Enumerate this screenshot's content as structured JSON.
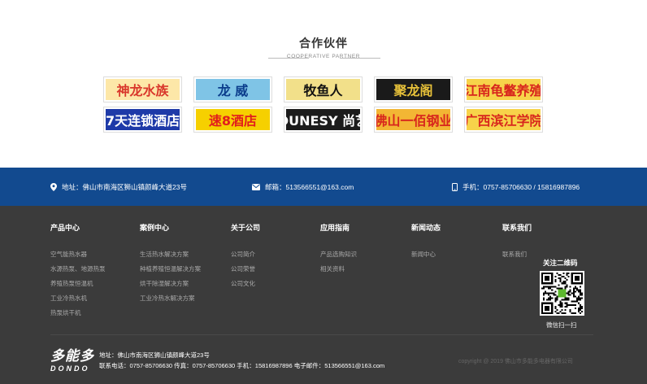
{
  "partners": {
    "title": "合作伙伴",
    "subtitle": "COOPERATIVE PARTNER",
    "logos": [
      {
        "text": "神龙水族",
        "color": "#d9372b",
        "bg": "#fde7a8"
      },
      {
        "text": "龙 威",
        "color": "#0b3d8c",
        "bg": "#7fc4e6"
      },
      {
        "text": "牧鱼人",
        "color": "#111111",
        "bg": "#f2e08a"
      },
      {
        "text": "聚龙阁",
        "color": "#e8c23a",
        "bg": "#1a1a1a"
      },
      {
        "text": "江南龟鳖养殖",
        "color": "#d8261d",
        "bg": "#f7d34a"
      },
      {
        "text": "7天连锁酒店",
        "color": "#ffffff",
        "bg": "#1e3aa8"
      },
      {
        "text": "速8酒店",
        "color": "#e11d1d",
        "bg": "#f6d000"
      },
      {
        "text": "DUNESY 尚艺",
        "color": "#ffffff",
        "bg": "#1c1c1c"
      },
      {
        "text": "佛山一佰钢业",
        "color": "#d8261d",
        "bg": "#f3b634"
      },
      {
        "text": "广西滨江学院",
        "color": "#d8261d",
        "bg": "#f7d34a"
      }
    ]
  },
  "contact_bar": {
    "address": "地址：佛山市南海区狮山镇颜峰大道23号",
    "email": "邮箱：513566551@163.com",
    "phone": "手机：0757-85706630 / 15816987896"
  },
  "footer": {
    "columns": [
      {
        "title": "产品中心",
        "links": [
          "空气能热水器",
          "水源热泵、地源热泵",
          "养殖热泵恒温机",
          "工业冷热水机",
          "热泵烘干机"
        ]
      },
      {
        "title": "案例中心",
        "links": [
          "生活热水解决方案",
          "种植养殖恒温解决方案",
          "烘干除湿解决方案",
          "工业冷热水解决方案"
        ]
      },
      {
        "title": "关于公司",
        "links": [
          "公司简介",
          "公司荣誉",
          "公司文化"
        ]
      },
      {
        "title": "应用指南",
        "links": [
          "产品选购知识",
          "相关资料"
        ]
      },
      {
        "title": "新闻动态",
        "links": [
          "新闻中心"
        ]
      },
      {
        "title": "联系我们",
        "links": [
          "联系我们"
        ]
      }
    ],
    "qr_title": "关注二维码",
    "qr_caption": "微信扫一扫",
    "brand_cn": "多能多",
    "brand_en": "DONDO",
    "address_line": "地址：佛山市南海区狮山镇颜峰大道23号",
    "contact_line": "联系电话：0757-85706630  传真：0757-85706630  手机：15816987896  电子邮件：513566551@163.com",
    "copyright": "copyright @ 2019 佛山市多能多电器有限公司"
  }
}
